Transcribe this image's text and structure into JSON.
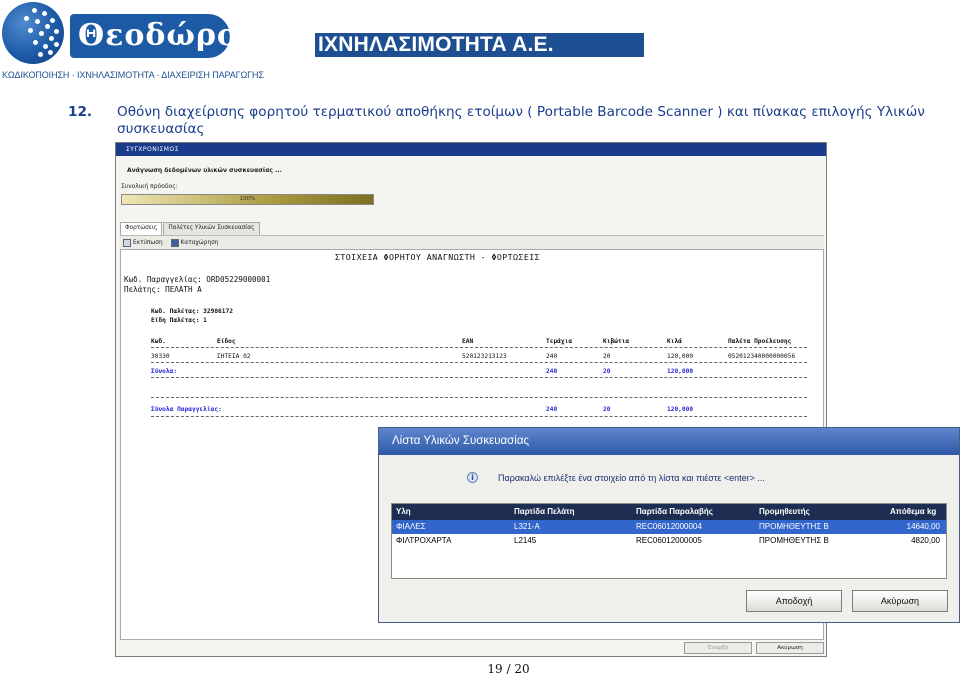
{
  "header": {
    "logo_name": "Θεοδώρου",
    "logo_tagline": "ΚΩΔΙΚΟΠΟΙΗΣΗ · ΙΧΝΗΛΑΣΙΜΟΤΗΤΑ · ΔΙΑΧΕΙΡΙΣΗ ΠΑΡΑΓΩΓΗΣ",
    "banner": "ΙΧΝΗΛΑΣΙΜΟΤΗΤΑ Α.Ε.",
    "brand_color": "#1d4f92"
  },
  "section": {
    "number": "12.",
    "title": "Οθόνη διαχείρισης φορητού τερματικού αποθήκης ετοίμων ( Portable Barcode Scanner ) και πίνακας επιλογής Υλικών συσκευασίας"
  },
  "app": {
    "window_title": "ΣΥΓΧΡΟΝΙΣΜΟΣ",
    "sync_status": "Ανάγνωση δεδομένων υλικών συσκευασίας ...",
    "progress_caption": "Συνολική πρόοδος:",
    "progress_percent": 100,
    "progress_text": "100%",
    "tabs": [
      "Φορτώσεις",
      "Παλέτες Υλικών Συσκευασίας"
    ],
    "toolbar": {
      "print": "Εκτύπωση",
      "save": "Καταχώρηση"
    },
    "report": {
      "title": "ΣΤΟΙΧΕΙΑ ΦΟΡΗΤΟΥ ΑΝΑΓΝΩΣΤΗ - ΦΟΡΤΩΣΕΙΣ",
      "order_code": "Κωδ. Παραγγελίας: ORD05229000001",
      "customer": "Πελάτης: ΠΕΛΑΤΗ Α",
      "pallet_code": "Κωδ. Παλέτας: 32986172",
      "pallet_type": "Είδη Παλέτας: 1",
      "columns": [
        "Κωδ.",
        "Είδος",
        "EAN",
        "Τεμάχια",
        "Κιβώτια",
        "Κιλά",
        "Παλέτα Προέλευσης"
      ],
      "row": [
        "30330",
        "ΣΗΤΕΙΑ 02",
        "520123213123",
        "240",
        "20",
        "120,000",
        "052012340000000056"
      ],
      "subtotal": {
        "label": "Σύνολα:",
        "pieces": "240",
        "boxes": "20",
        "kilos": "120,000"
      },
      "order_total": {
        "label": "Σύνολα Παραγγελίας:",
        "pieces": "240",
        "boxes": "20",
        "kilos": "120,000"
      }
    },
    "buttons": {
      "start": "Έναρξη",
      "cancel": "Ακύρωση"
    }
  },
  "dialog": {
    "title": "Λίστα Υλικών Συσκευασίας",
    "message": "Παρακαλώ επιλέξτε ένα στοιχείο από τη λίστα και πιέστε <enter> ...",
    "columns": [
      "Υλη",
      "Παρτίδα Πελάτη",
      "Παρτίδα Παραλαβής",
      "Προμηθευτής",
      "Απόθεμα kg"
    ],
    "rows": [
      [
        "ΦΙΑΛΕΣ",
        "L321-A",
        "REC06012000004",
        "ΠΡΟΜΗΘΕΥΤΗΣ Β",
        "14640,00"
      ],
      [
        "ΦΙΛΤΡΟΧΑΡΤΑ",
        "L2145",
        "REC06012000005",
        "ΠΡΟΜΗΘΕΥΤΗΣ Β",
        "4820,00"
      ]
    ],
    "selected_row": 0,
    "ok_button": "Αποδοχή",
    "cancel_button": "Ακύρωση"
  },
  "page_number": "19 / 20"
}
